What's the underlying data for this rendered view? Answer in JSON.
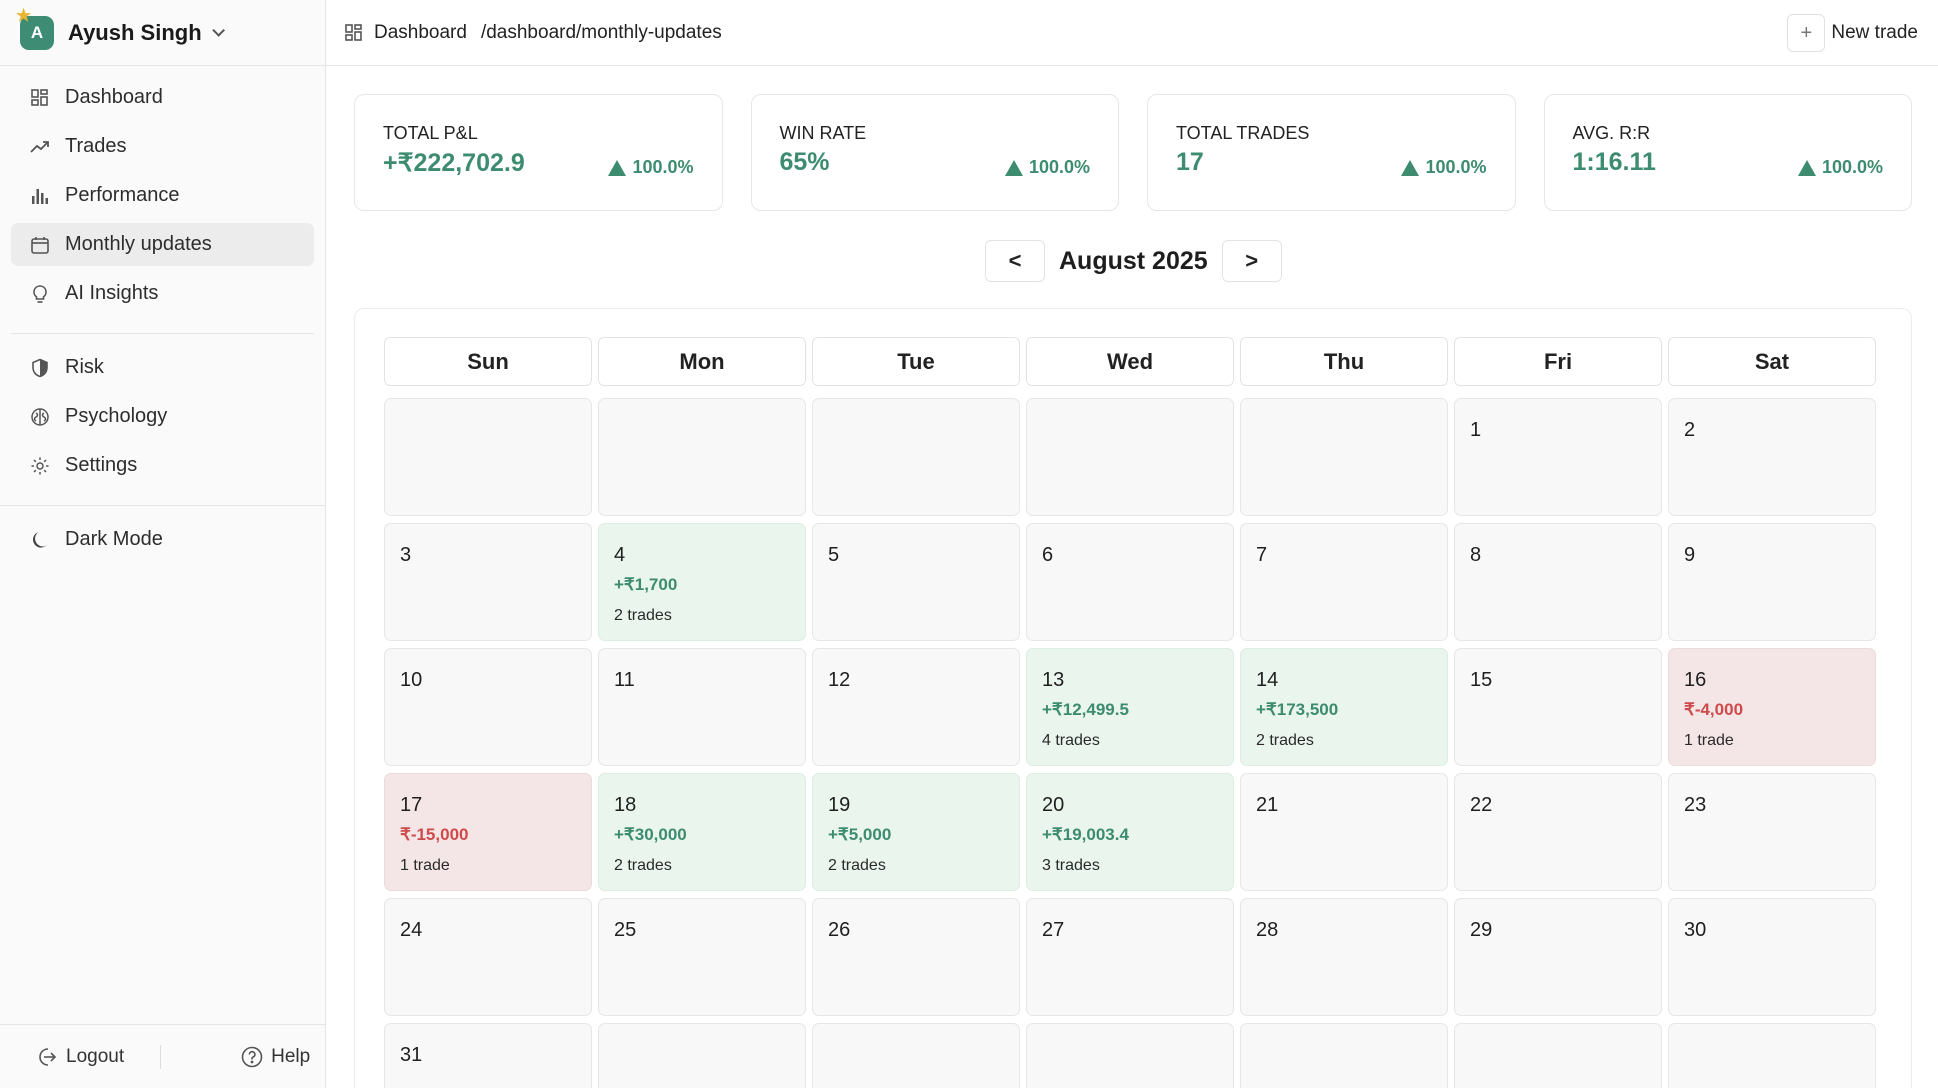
{
  "user": {
    "name": "Ayush Singh",
    "initial": "A"
  },
  "sidebar": {
    "items": [
      {
        "label": "Dashboard",
        "icon": "grid-icon"
      },
      {
        "label": "Trades",
        "icon": "trend-icon"
      },
      {
        "label": "Performance",
        "icon": "bar-chart-icon"
      },
      {
        "label": "Monthly updates",
        "icon": "calendar-icon",
        "active": true
      },
      {
        "label": "AI Insights",
        "icon": "lightbulb-icon"
      },
      {
        "label": "Risk",
        "icon": "shield-icon"
      },
      {
        "label": "Psychology",
        "icon": "brain-icon"
      },
      {
        "label": "Settings",
        "icon": "gear-icon"
      },
      {
        "label": "Dark Mode",
        "icon": "moon-icon"
      }
    ],
    "logout": "Logout",
    "help": "Help"
  },
  "header": {
    "crumb": "Dashboard",
    "path": "/dashboard/monthly-updates",
    "new_trade": "New trade"
  },
  "stats": [
    {
      "label": "TOTAL P&L",
      "value": "+₹222,702.9",
      "change": "100.0%"
    },
    {
      "label": "WIN RATE",
      "value": "65%",
      "change": "100.0%"
    },
    {
      "label": "TOTAL TRADES",
      "value": "17",
      "change": "100.0%"
    },
    {
      "label": "AVG. R:R",
      "value": "1:16.11",
      "change": "100.0%"
    }
  ],
  "calendar": {
    "month_label": "August 2025",
    "prev": "<",
    "next": ">",
    "weekdays": [
      "Sun",
      "Mon",
      "Tue",
      "Wed",
      "Thu",
      "Fri",
      "Sat"
    ],
    "days": {
      "4": {
        "pnl": "+₹1,700",
        "trades": "2 trades",
        "kind": "pos"
      },
      "13": {
        "pnl": "+₹12,499.5",
        "trades": "4 trades",
        "kind": "pos"
      },
      "14": {
        "pnl": "+₹173,500",
        "trades": "2 trades",
        "kind": "pos"
      },
      "16": {
        "pnl": "₹-4,000",
        "trades": "1 trade",
        "kind": "neg"
      },
      "17": {
        "pnl": "₹-15,000",
        "trades": "1 trade",
        "kind": "neg"
      },
      "18": {
        "pnl": "+₹30,000",
        "trades": "2 trades",
        "kind": "pos"
      },
      "19": {
        "pnl": "+₹5,000",
        "trades": "2 trades",
        "kind": "pos"
      },
      "20": {
        "pnl": "+₹19,003.4",
        "trades": "3 trades",
        "kind": "pos"
      }
    },
    "first_weekday": 5,
    "num_days": 31
  },
  "colors": {
    "accent": "#3d8c6f",
    "negative": "#cf4a4a"
  }
}
